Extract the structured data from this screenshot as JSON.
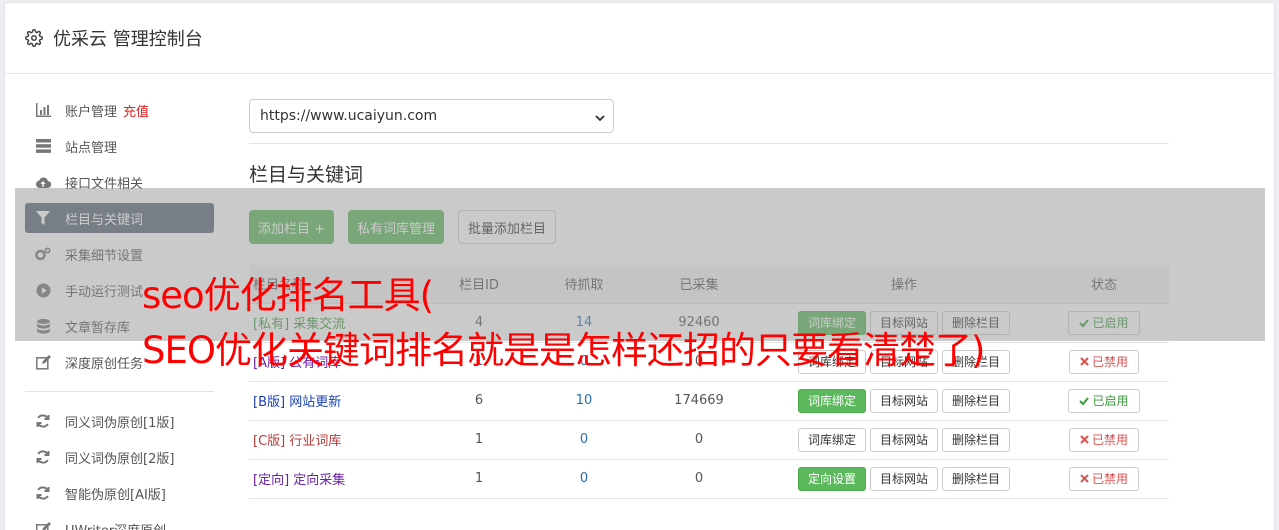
{
  "header": {
    "title": "优采云 管理控制台",
    "icon": "gear-icon"
  },
  "sidebar": {
    "items": [
      {
        "label": "账户管理",
        "extra": "充值",
        "icon": "bar-chart-icon"
      },
      {
        "label": "站点管理",
        "icon": "server-icon"
      },
      {
        "label": "接口文件相关",
        "icon": "cloud-upload-icon"
      },
      {
        "label": "栏目与关键词",
        "icon": "filter-icon",
        "active": true
      },
      {
        "label": "采集细节设置",
        "icon": "cogs-icon"
      },
      {
        "label": "手动运行测试",
        "icon": "play-circle-icon"
      },
      {
        "label": "文章暂存库",
        "icon": "database-icon"
      },
      {
        "label": "深度原创任务",
        "icon": "edit-icon"
      }
    ],
    "items2": [
      {
        "label": "同义词伪原创[1版]",
        "icon": "refresh-icon"
      },
      {
        "label": "同义词伪原创[2版]",
        "icon": "refresh-icon"
      },
      {
        "label": "智能伪原创[AI版]",
        "icon": "refresh-icon"
      },
      {
        "label": "UWriter深度原创",
        "icon": "edit-icon"
      }
    ]
  },
  "main": {
    "site_select": "https://www.ucaiyun.com",
    "section_title": "栏目与关键词",
    "buttons": {
      "add_column": "添加栏目 +",
      "private_lib": "私有词库管理",
      "batch_add": "批量添加栏目"
    },
    "table": {
      "headers": [
        "栏目名称",
        "栏目ID",
        "待抓取",
        "已采集",
        "操作",
        "状态"
      ],
      "rows": [
        {
          "tag": "[私有]",
          "name": "采集交流",
          "id": "4",
          "pending": "14",
          "collected": "92460",
          "op1": "词库绑定",
          "op1_green": true,
          "op2": "目标网站",
          "op3": "删除栏目",
          "status": "已启用",
          "on": true,
          "color": "green"
        },
        {
          "tag": "[A版]",
          "name": "公有词库",
          "id": "1",
          "pending": "0",
          "collected": "0",
          "op1": "词库绑定",
          "op1_green": false,
          "op2": "目标网站",
          "op3": "删除栏目",
          "status": "已禁用",
          "on": false,
          "color": "purple"
        },
        {
          "tag": "[B版]",
          "name": "网站更新",
          "id": "6",
          "pending": "10",
          "collected": "174669",
          "op1": "词库绑定",
          "op1_green": true,
          "op2": "目标网站",
          "op3": "删除栏目",
          "status": "已启用",
          "on": true,
          "color": "blue"
        },
        {
          "tag": "[C版]",
          "name": "行业词库",
          "id": "1",
          "pending": "0",
          "collected": "0",
          "op1": "词库绑定",
          "op1_green": false,
          "op2": "目标网站",
          "op3": "删除栏目",
          "status": "已禁用",
          "on": false,
          "color": "red"
        },
        {
          "tag": "[定向]",
          "name": "定向采集",
          "id": "1",
          "pending": "0",
          "collected": "0",
          "op1": "定向设置",
          "op1_green": true,
          "op2": "目标网站",
          "op3": "删除栏目",
          "status": "已禁用",
          "on": false,
          "color": "purple"
        }
      ]
    }
  },
  "overlay": {
    "line1": "seo优化排名工具(",
    "line2": "SEO优化关键词排名就是是怎样还招的只要看清楚了)"
  },
  "colors": {
    "accent_green": "#5cb85c",
    "active_nav": "#5b6776",
    "overlay_text": "#ff0000"
  }
}
